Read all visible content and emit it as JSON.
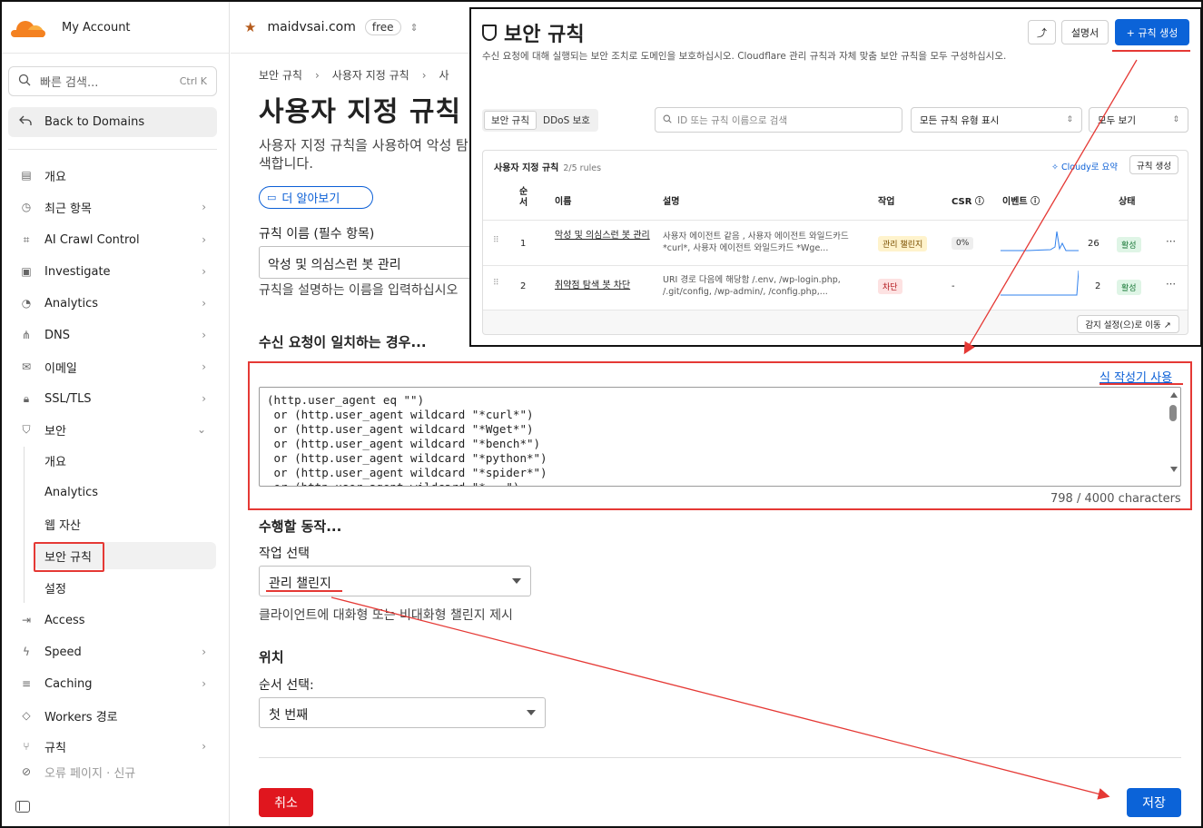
{
  "sidebar": {
    "account": "My Account",
    "search_placeholder": "빠른 검색...",
    "search_shortcut": "Ctrl K",
    "back": "Back to Domains",
    "items": [
      {
        "label": "개요",
        "icon": "document-icon",
        "chevron": false
      },
      {
        "label": "최근 항목",
        "icon": "history-icon",
        "chevron": true
      },
      {
        "label": "AI Crawl Control",
        "icon": "ai-crawl-icon",
        "chevron": true
      },
      {
        "label": "Investigate",
        "icon": "investigate-icon",
        "chevron": true
      },
      {
        "label": "Analytics",
        "icon": "analytics-icon",
        "chevron": true
      },
      {
        "label": "DNS",
        "icon": "dns-icon",
        "chevron": true
      },
      {
        "label": "이메일",
        "icon": "email-icon",
        "chevron": true
      },
      {
        "label": "SSL/TLS",
        "icon": "lock-icon",
        "chevron": true
      },
      {
        "label": "보안",
        "icon": "shield-icon",
        "chevron": true
      }
    ],
    "security_sub": [
      "개요",
      "Analytics",
      "웹 자산",
      "보안 규칙",
      "설정"
    ],
    "items_after": [
      {
        "label": "Access",
        "icon": "access-icon",
        "chevron": false
      },
      {
        "label": "Speed",
        "icon": "speed-icon",
        "chevron": true
      },
      {
        "label": "Caching",
        "icon": "caching-icon",
        "chevron": true
      },
      {
        "label": "Workers 경로",
        "icon": "workers-icon",
        "chevron": false
      },
      {
        "label": "규칙",
        "icon": "rules-icon",
        "chevron": true
      },
      {
        "label": "오류 페이지 · 신규",
        "icon": "error-page-icon",
        "chevron": false
      }
    ]
  },
  "topbar": {
    "domain": "maidvsai.com",
    "plan": "free"
  },
  "main": {
    "breadcrumb": [
      "보안 규칙",
      "사용자 지정 규칙",
      "사"
    ],
    "title": "사용자 지정 규칙",
    "desc": "사용자 지정 규칙을 사용하여 악성 탐색합니다.",
    "learn_more": "더 알아보기",
    "rule_name_label": "규칙 이름 (필수 항목)",
    "rule_name_value": "악성 및 의심스런 봇 관리",
    "rule_name_help": "규칙을 설명하는 이름을 입력하십시오",
    "when_title": "수신 요청이 일치하는 경우...",
    "expr_builder_link": "식 작성기 사용",
    "expression": "(http.user_agent eq \"\")\n or (http.user_agent wildcard \"*curl*\")\n or (http.user_agent wildcard \"*Wget*\")\n or (http.user_agent wildcard \"*bench*\")\n or (http.user_agent wildcard \"*python*\")\n or (http.user_agent wildcard \"*spider*\")\n or (http.user_agent wildcard \"*...\")",
    "char_count": "798 / 4000 characters",
    "action_title": "수행할 동작...",
    "action_label": "작업 선택",
    "action_value": "관리 챌린지",
    "action_help": "클라이언트에 대화형 또는 비대화형 챌린지 제시",
    "position_title": "위치",
    "order_label": "순서 선택:",
    "order_value": "첫 번째",
    "cancel": "취소",
    "save": "저장"
  },
  "panel": {
    "title": "보안 규칙",
    "desc": "수신 요청에 대해 실행되는 보안 조치로 도메인을 보호하십시오. Cloudflare 관리 규칙과 자체 맞춤 보안 규칙을 모두 구성하십시오.",
    "docs": "설명서",
    "create": "+ 규칙 생성",
    "tabs": [
      "보안 규칙",
      "DDoS 보호"
    ],
    "search_placeholder": "ID 또는 규칙 이름으로 검색",
    "type_filter": "모든 규칙 유형 표시",
    "view_filter": "모두 보기",
    "card_title": "사용자 지정 규칙",
    "card_count": "2/5 rules",
    "cloudy": "Cloudy로 요약",
    "card_create": "규칙 생성",
    "columns": [
      "순서",
      "이름",
      "설명",
      "작업",
      "CSR ⓘ",
      "이벤트 ⓘ",
      "상태"
    ],
    "rows": [
      {
        "order": "1",
        "name": "악성 및 의심스런 봇 관리",
        "desc": "사용자 에이전트 같음 , 사용자 에이전트 와일드카드 *curl*, 사용자 에이전트 와일드카드 *Wge...",
        "action": "관리 챌린지",
        "csr": "0%",
        "events": "26",
        "status": "활성"
      },
      {
        "order": "2",
        "name": "취약점 탐색 봇 차단",
        "desc": "URI 경로 다음에 해당함 /.env, /wp-login.php, /.git/config, /wp-admin/, /config.php,...",
        "action": "차단",
        "csr": "-",
        "events": "2",
        "status": "활성"
      }
    ],
    "footer_link": "감지 설정(으)로 이동 ↗"
  },
  "colors": {
    "accent": "#0b63d8",
    "danger": "#e0161e",
    "annotation": "#e53935",
    "brand": "#f48120"
  }
}
